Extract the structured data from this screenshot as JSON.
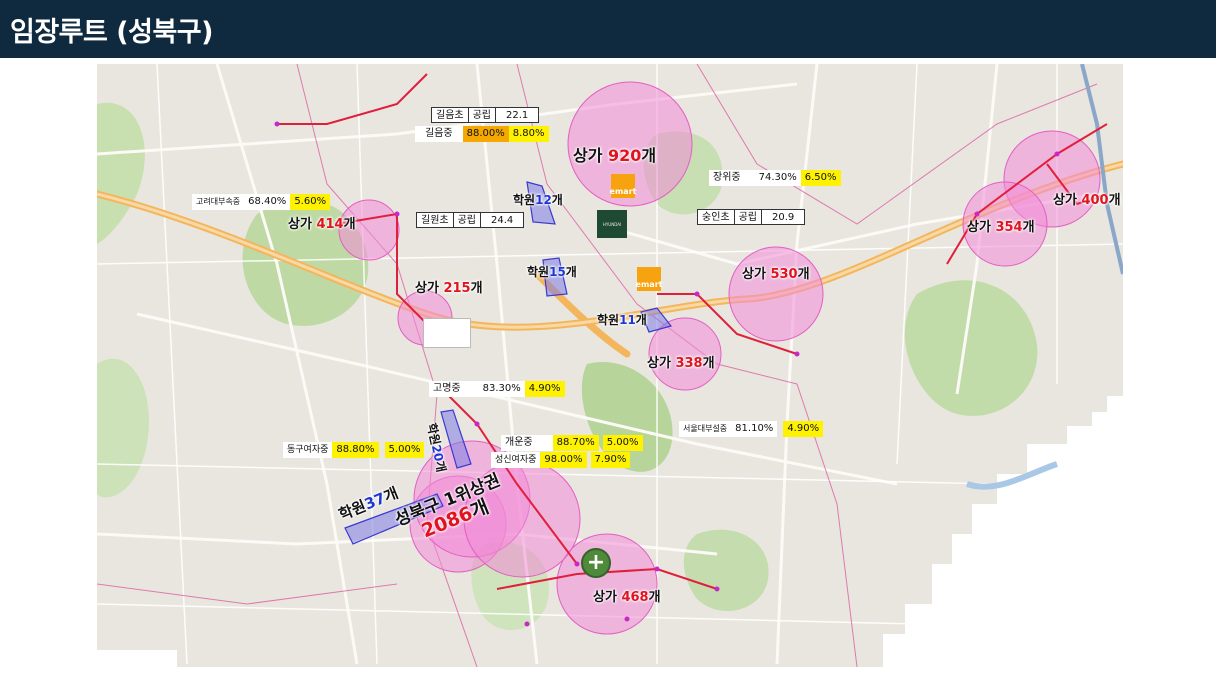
{
  "header": {
    "title": "임장루트 (성북구)"
  },
  "colors": {
    "header_bg": "#0f2a3e",
    "commercial_zone": "#f0a0d8",
    "academy_zone": "#7d7ce6",
    "count_red": "#e0141e",
    "count_blue": "#1c36d6",
    "rate_yellow": "#fff200",
    "rate_orange": "#f5a800"
  },
  "commercial": [
    {
      "id": "c920",
      "prefix": "상가 ",
      "count": "920",
      "suffix": "개"
    },
    {
      "id": "c400",
      "prefix": "상가 ",
      "count": "400",
      "suffix": "개"
    },
    {
      "id": "c354",
      "prefix": "상가 ",
      "count": "354",
      "suffix": "개"
    },
    {
      "id": "c414",
      "prefix": "상가 ",
      "count": "414",
      "suffix": "개"
    },
    {
      "id": "c530",
      "prefix": "상가 ",
      "count": "530",
      "suffix": "개"
    },
    {
      "id": "c215",
      "prefix": "상가 ",
      "count": "215",
      "suffix": "개"
    },
    {
      "id": "c338",
      "prefix": "상가 ",
      "count": "338",
      "suffix": "개"
    },
    {
      "id": "c468",
      "prefix": "상가 ",
      "count": "468",
      "suffix": "개"
    }
  ],
  "academies": [
    {
      "id": "a12",
      "prefix": "학원",
      "count": "12",
      "suffix": "개"
    },
    {
      "id": "a15",
      "prefix": "학원",
      "count": "15",
      "suffix": "개"
    },
    {
      "id": "a11",
      "prefix": "학원",
      "count": "11",
      "suffix": "개"
    },
    {
      "id": "a20",
      "prefix": "학원",
      "count": "20",
      "suffix": "개"
    },
    {
      "id": "a37",
      "prefix": "학원",
      "count": "37",
      "suffix": "개"
    }
  ],
  "main_zone": {
    "line1": "성북구 1위상권",
    "count": "2086",
    "suffix": "개"
  },
  "schools": [
    {
      "id": "s1",
      "name": "길음초",
      "type": "공립",
      "value": "22.1"
    },
    {
      "id": "s2",
      "name": "길원초",
      "type": "공립",
      "value": "24.4"
    },
    {
      "id": "s3",
      "name": "숭인초",
      "type": "공립",
      "value": "20.9"
    }
  ],
  "middle_schools": [
    {
      "id": "m1",
      "name": "길음중",
      "rate1": "88.00%",
      "rate2": "8.80%"
    },
    {
      "id": "m2",
      "name": "장위중",
      "rate1": "74.30%",
      "rate2": "6.50%"
    },
    {
      "id": "m3",
      "name": "고려대부속중",
      "rate1": "68.40%",
      "rate2": "5.60%"
    },
    {
      "id": "m4",
      "name": "고명중",
      "rate1": "83.30%",
      "rate2": "4.90%"
    },
    {
      "id": "m5",
      "name": "동구여자중",
      "rate1": "88.80%",
      "rate2": "5.00%"
    },
    {
      "id": "m6",
      "name": "개운중",
      "rate1": "88.70%",
      "rate2": "5.00%"
    },
    {
      "id": "m7",
      "name": "성신여자중",
      "rate1": "98.00%",
      "rate2": "7.90%"
    },
    {
      "id": "m8",
      "name": "서울대부설중",
      "rate1": "81.10%",
      "rate2": "4.90%"
    }
  ],
  "logos": {
    "emart": "emart",
    "hyundai": "HYUNDAI",
    "hospital": "+"
  },
  "icons": [
    "emart-logo-icon",
    "hyundai-logo-icon",
    "hospital-cross-icon"
  ]
}
